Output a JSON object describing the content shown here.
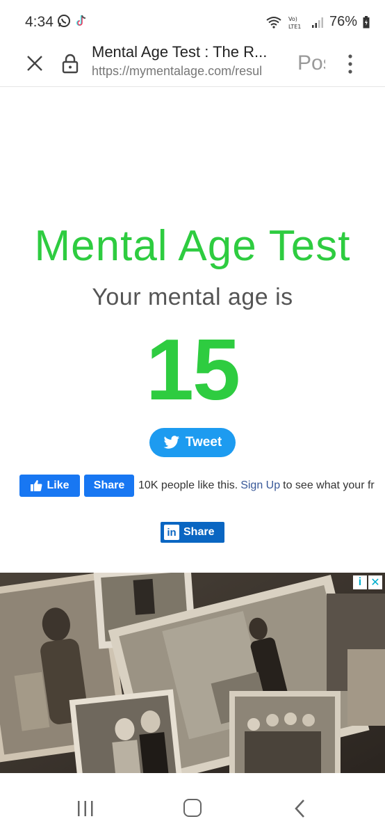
{
  "status_bar": {
    "time": "4:34",
    "battery": "76%",
    "network": "Vo) LTE1"
  },
  "browser": {
    "page_title": "Mental Age Test : The R...",
    "url": "https://mymentalage.com/resul",
    "overflow_text": "Pos"
  },
  "main": {
    "heading": "Mental Age Test",
    "subheading": "Your mental age is",
    "age": "15"
  },
  "social": {
    "tweet_label": "Tweet",
    "fb_like_label": "Like",
    "fb_share_label": "Share",
    "fb_count_text": "10K people like this.",
    "fb_signup_text": "Sign Up",
    "fb_rest_text": "to see what your fr",
    "linkedin_share_label": "Share",
    "linkedin_logo": "in"
  },
  "ad": {
    "info_glyph": "i",
    "close_glyph": "✕"
  },
  "colors": {
    "brand_green": "#2ecc40",
    "twitter_blue": "#1d9bf0",
    "facebook_blue": "#1877f2",
    "linkedin_blue": "#0a66c2"
  }
}
